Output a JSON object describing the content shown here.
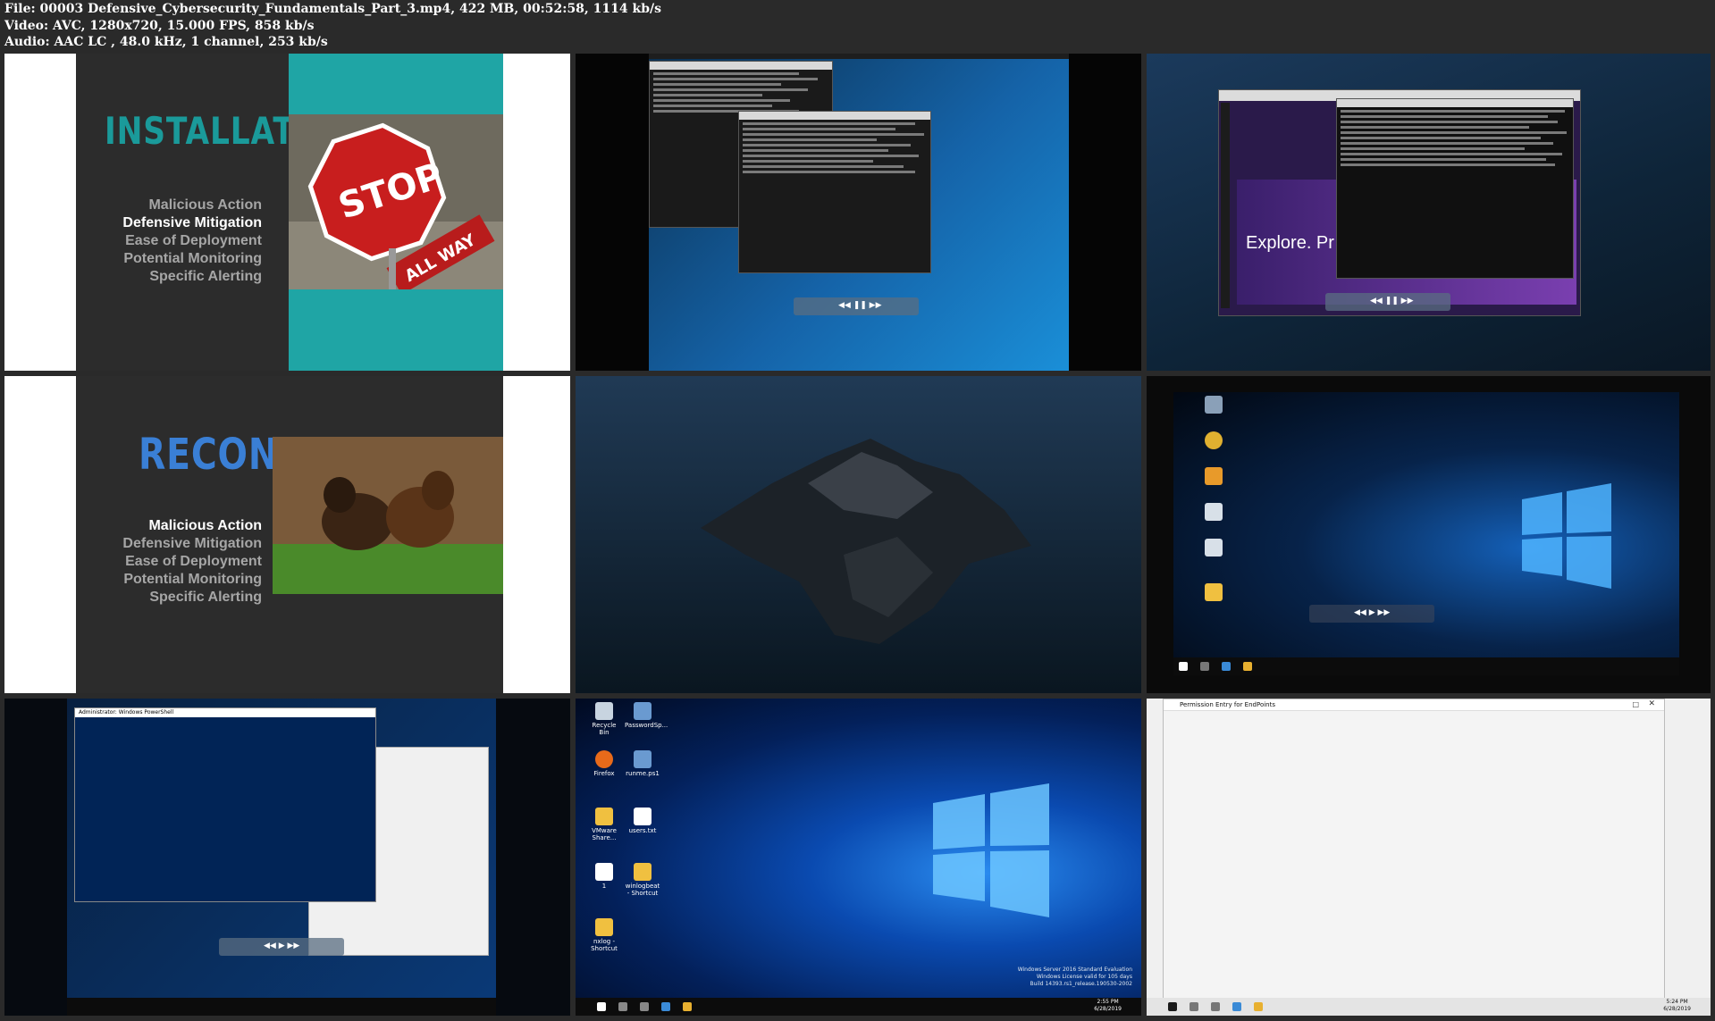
{
  "file_info": {
    "line1": "File: 00003 Defensive_Cybersecurity_Fundamentals_Part_3.mp4, 422 MB, 00:52:58, 1114 kb/s",
    "line2": "Video: AVC, 1280x720, 15.000 FPS, 858 kb/s",
    "line3": "Audio: AAC LC , 48.0 kHz, 1 channel, 253 kb/s"
  },
  "slide1": {
    "title": "INSTALLATION",
    "title_color": "#1a9a9a",
    "items": [
      "Malicious Action",
      "Defensive Mitigation",
      "Ease of Deployment",
      "Potential Monitoring",
      "Specific Alerting"
    ],
    "active_index": 1,
    "stop_sign_text": "STOP",
    "sign_subtext": "ALL WAY"
  },
  "slide2": {
    "title": "RECON",
    "title_color": "#3a7fd5",
    "items": [
      "Malicious Action",
      "Defensive Mitigation",
      "Ease of Deployment",
      "Potential Monitoring",
      "Specific Alerting"
    ],
    "active_index": 0
  },
  "tile3": {
    "browser_text": "Explore. Pr"
  },
  "tile7": {
    "ps_title": "Administrator: Windows PowerShell"
  },
  "tile8": {
    "icons": [
      "Recycle Bin",
      "PasswordSp...",
      "Firefox",
      "runme.ps1",
      "VMware Share...",
      "users.txt",
      "1",
      "winlogbeat - Shortcut",
      "nxlog - Shortcut"
    ],
    "watermark1": "Windows Server 2016 Standard Evaluation",
    "watermark2": "Windows License valid for 105 days",
    "watermark3": "Build 14393.rs1_release.190530-2002",
    "clock_time": "2:55 PM",
    "clock_date": "6/28/2019"
  },
  "tile9": {
    "dialog_title": "Permission Entry for EndPoints",
    "clock_time": "5:24 PM",
    "clock_date": "6/28/2019"
  },
  "colors": {
    "teal": "#1fa5a5",
    "slide_dark": "#2c2c2c",
    "win_blue": "#0a64d6"
  }
}
